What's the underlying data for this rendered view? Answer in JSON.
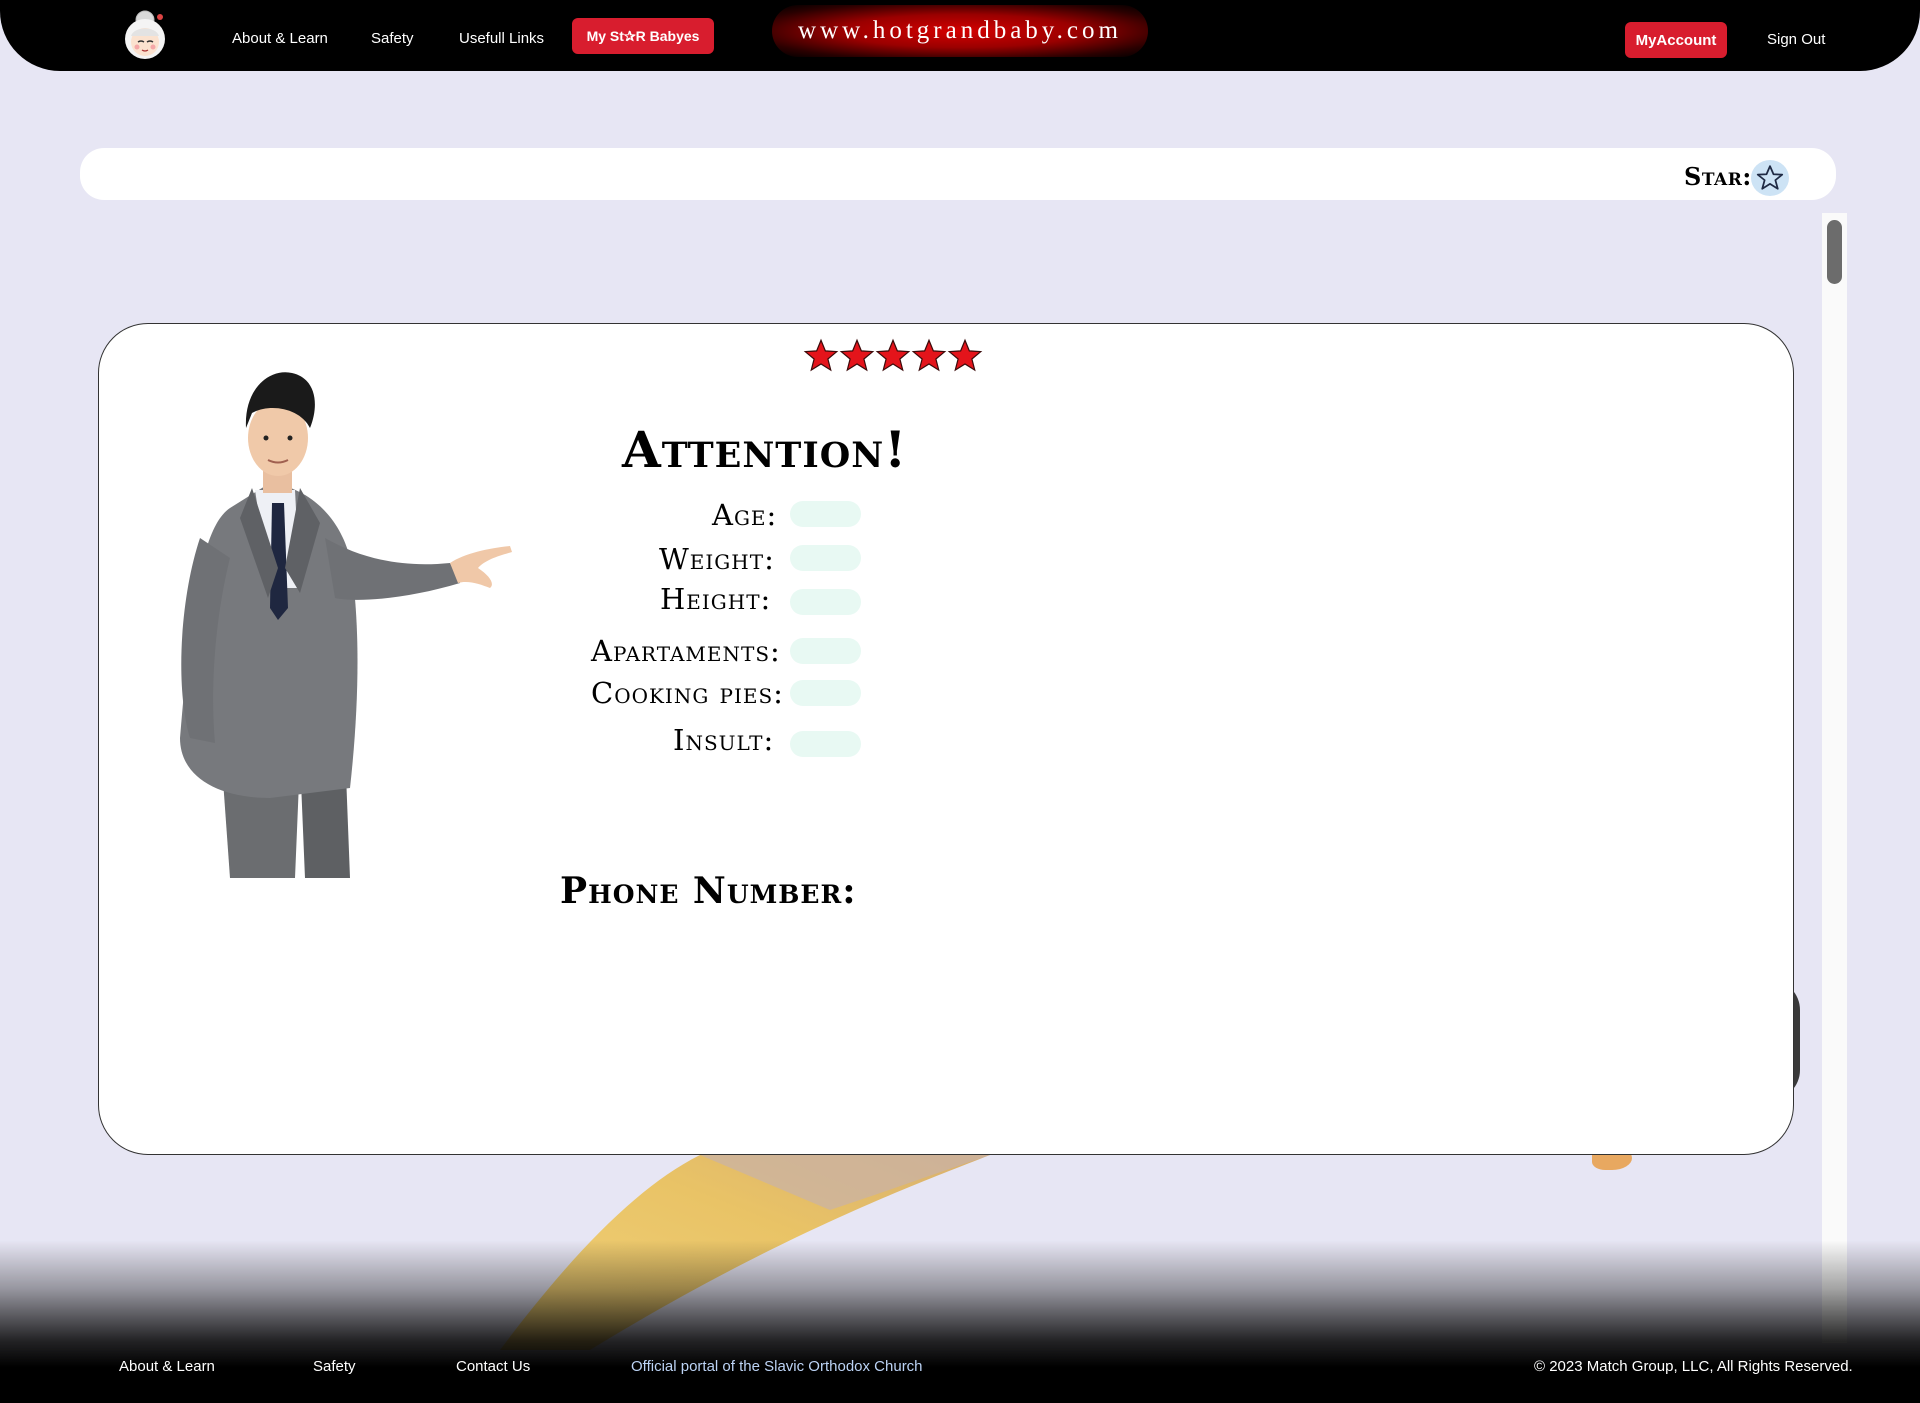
{
  "header": {
    "nav": [
      {
        "label": "About & Learn"
      },
      {
        "label": "Safety"
      },
      {
        "label": "Usefull Links"
      }
    ],
    "my_stars_label": "My St✰R Babyes",
    "site_url": "www.hotgrandbaby.com",
    "my_account_label": "MyAccount",
    "sign_out_label": "Sign Out",
    "logo_icon": "grandmother-face-icon"
  },
  "starbar": {
    "label": "Star:",
    "icon": "star-outline-icon",
    "starred": false
  },
  "profile": {
    "rating": 5,
    "rating_max": 5,
    "rating_color": "#e4141b",
    "heading": "Attention!",
    "fields": [
      {
        "label": "Age:",
        "value": ""
      },
      {
        "label": "Weight:",
        "value": ""
      },
      {
        "label": "Height:",
        "value": ""
      },
      {
        "label": "Apartaments:",
        "value": ""
      },
      {
        "label": "Cooking pies:",
        "value": ""
      },
      {
        "label": "Insult:",
        "value": ""
      }
    ],
    "phone_label": "Phone Number:",
    "phone_value": ""
  },
  "footer": {
    "links": [
      {
        "label": "About & Learn"
      },
      {
        "label": "Safety"
      },
      {
        "label": "Contact Us"
      },
      {
        "label": "Official portal of the Slavic Orthodox Church"
      }
    ],
    "copyright": "© 2023 Match Group, LLC, All Rights Reserved."
  },
  "colors": {
    "background": "#e7e6f4",
    "accent_red": "#d81d2e",
    "field_fill": "#e8f9f3"
  }
}
